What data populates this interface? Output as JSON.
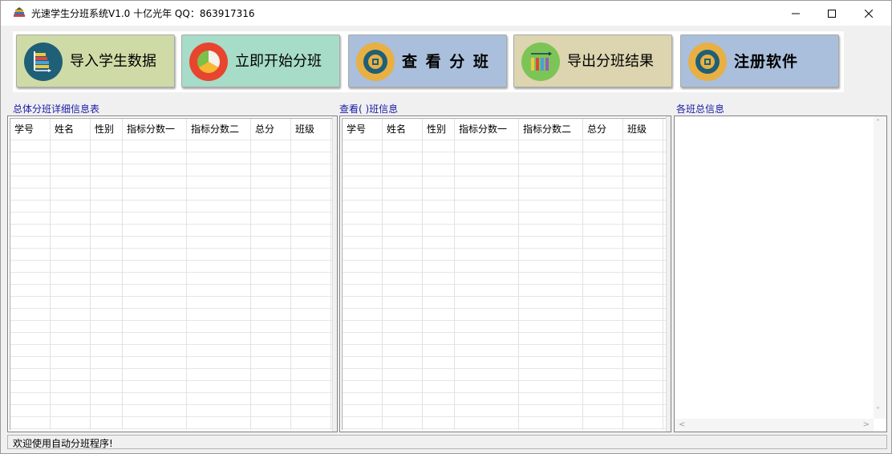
{
  "window": {
    "title": "光速学生分班系统V1.0 十亿光年 QQ：863917316"
  },
  "toolbar": {
    "import_label": "导入学生数据",
    "start_label": "立即开始分班",
    "view_label": "查 看 分 班",
    "export_label": "导出分班结果",
    "register_label": "注册软件"
  },
  "sections": {
    "overall_label": "总体分班详细信息表",
    "class_label": "查看(  )班信息",
    "summary_label": "各班总信息"
  },
  "columns": [
    "学号",
    "姓名",
    "性别",
    "指标分数一",
    "指标分数二",
    "总分",
    "班级"
  ],
  "status": {
    "text": "欢迎使用自动分班程序!"
  },
  "colors": {
    "label_blue": "#1a1aa8",
    "btn_import": "#cfdba6",
    "btn_start": "#a7dcc8",
    "btn_view": "#a9bfdc",
    "btn_export": "#dcd5b0",
    "btn_register": "#a9bfdc"
  },
  "icons": {
    "app": "books-icon",
    "import": "books-stack-icon",
    "start": "pie-chart-icon",
    "view": "donut-target-icon",
    "export": "bar-chart-arrow-icon",
    "register": "donut-target-icon"
  }
}
